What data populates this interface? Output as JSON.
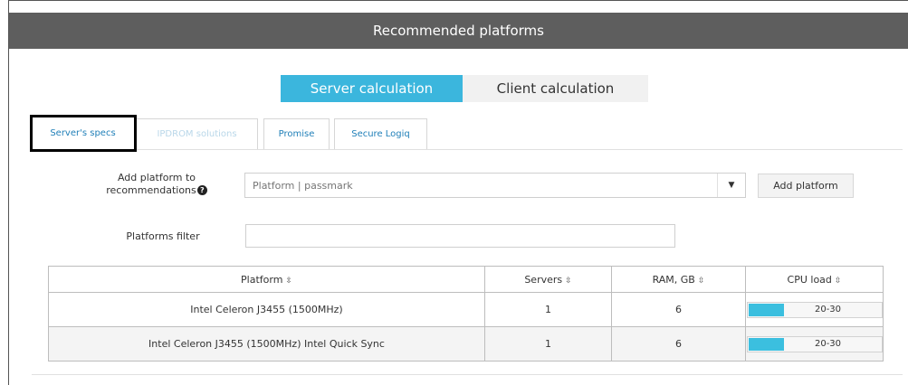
{
  "window": {
    "title": "Recommended platforms"
  },
  "modes": {
    "server_label": "Server calculation",
    "client_label": "Client calculation",
    "active": "server"
  },
  "tabs": [
    {
      "label": "Server's specs",
      "active": true
    },
    {
      "label": "IPDROM solutions",
      "disabled": true
    },
    {
      "label": "Promise"
    },
    {
      "label": "Secure Logiq"
    }
  ],
  "form": {
    "add_platform_label_line1": "Add platform to",
    "add_platform_label_line2": "recommendations",
    "help_icon": "question-circle-icon",
    "platform_placeholder": "Platform | passmark",
    "dropdown_icon": "caret-down-icon",
    "add_button_label": "Add platform",
    "filter_label": "Platforms filter",
    "filter_value": ""
  },
  "table": {
    "columns": [
      {
        "label": "Platform",
        "sortable": true
      },
      {
        "label": "Servers",
        "sortable": true
      },
      {
        "label": "RAM, GB",
        "sortable": true
      },
      {
        "label": "CPU load",
        "sortable": true
      }
    ],
    "sort_icon": "⇳",
    "rows": [
      {
        "platform": "Intel Celeron J3455 (1500MHz)",
        "servers": "1",
        "ram": "6",
        "cpu_load": "20-30",
        "cpu_fill_fraction": 0.27
      },
      {
        "platform": "Intel Celeron J3455 (1500MHz) Intel Quick Sync",
        "servers": "1",
        "ram": "6",
        "cpu_load": "20-30",
        "cpu_fill_fraction": 0.27
      }
    ]
  },
  "colors": {
    "accent": "#3bb6dd",
    "titlebar": "#5e5e5e",
    "tab_link": "#1f7fb8",
    "tab_disabled": "#b9d7e9",
    "load_fill": "#3bbfdf"
  }
}
